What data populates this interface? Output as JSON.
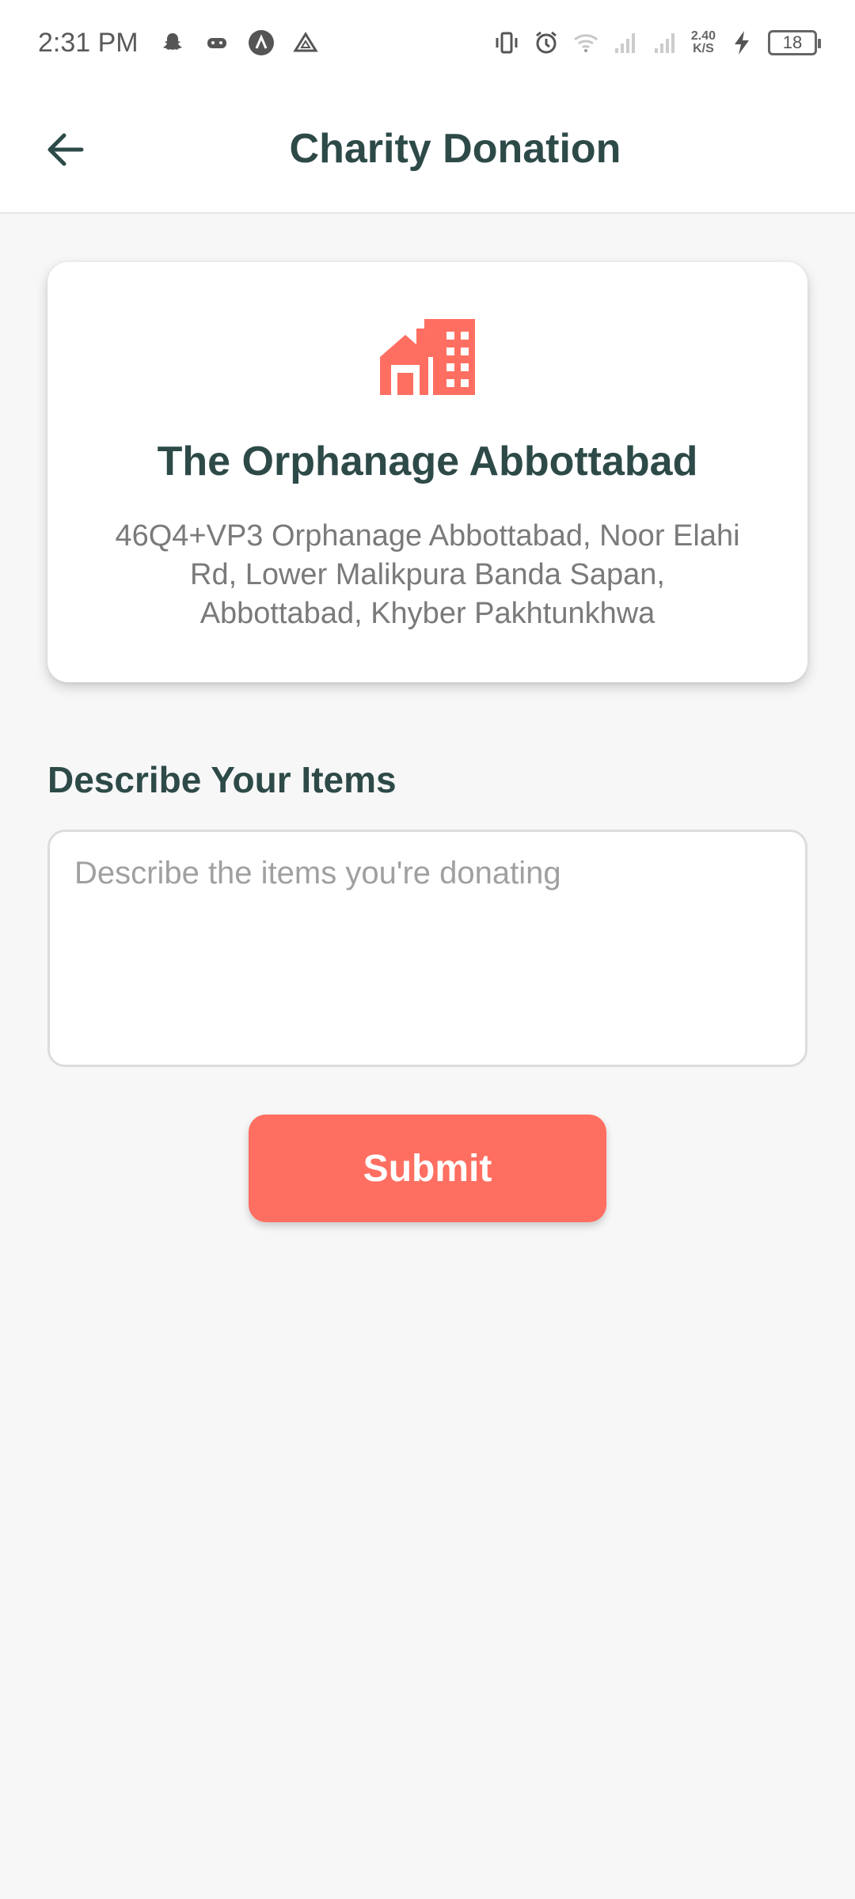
{
  "status_bar": {
    "time": "2:31 PM",
    "net_speed_value": "2.40",
    "net_speed_unit": "K/S",
    "battery": "18",
    "left_icons": [
      "snapchat-icon",
      "game-controller-icon",
      "app-a-icon",
      "drive-icon"
    ],
    "right_icons": [
      "vibrate-icon",
      "alarm-icon",
      "wifi-icon",
      "signal-icon",
      "signal-icon",
      "charging-icon"
    ]
  },
  "app_bar": {
    "title": "Charity Donation",
    "back_icon": "arrow-left-icon"
  },
  "organization": {
    "icon": "home-building-icon",
    "name": "The Orphanage Abbottabad",
    "address": "46Q4+VP3 Orphanage Abbottabad, Noor Elahi Rd, Lower Malikpura Banda Sapan, Abbottabad, Khyber Pakhtunkhwa"
  },
  "form": {
    "section_label": "Describe Your Items",
    "items_value": "",
    "items_placeholder": "Describe the items you're donating",
    "submit_label": "Submit"
  },
  "colors": {
    "primary_text": "#2d4a48",
    "accent": "#ff6f61",
    "background": "#f7f7f7"
  }
}
